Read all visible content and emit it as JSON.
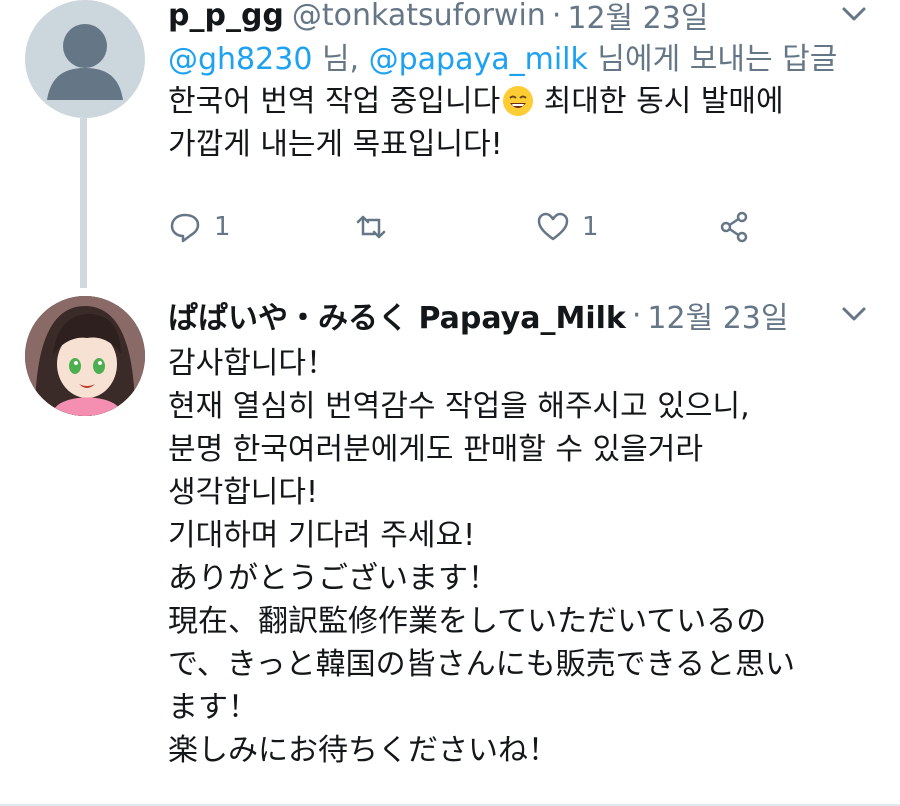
{
  "tweet1": {
    "name": "p_p_gg",
    "handle": "@tonkatsuforwin",
    "separator": "·",
    "time": "12월 23일",
    "reply_mention1": "@gh8230",
    "reply_mid": " 님, ",
    "reply_mention2": "@papaya_milk",
    "reply_suffix": " 님에게 보내는 답글",
    "body_line1a": "한국어 번역 작업 중입니다",
    "body_line1b": " 최대한 동시 발매에",
    "body_line2": "가깝게 내는게 목표입니다!",
    "reply_count": "1",
    "like_count": "1"
  },
  "tweet2": {
    "name": "ぱぱいや・みるく Papaya_Milk",
    "separator": "·",
    "time": "12월 23일",
    "body": "감사합니다！\n현재 열심히 번역감수 작업을 해주시고 있으니,\n분명 한국여러분에게도 판매할 수 있을거라\n생각합니다!\n기대하며 기다려 주세요!\nありがとうございます！\n現在、翻訳監修作業をしていただいているの\nで、きっと韓国の皆さんにも販売できると思い\nます！\n楽しみにお待ちくださいね！"
  },
  "colors": {
    "accent": "#1da1f2",
    "muted": "#657786",
    "text": "#14171a",
    "thread_line": "#cfd9de"
  },
  "icons": [
    "reply-icon",
    "retweet-icon",
    "like-icon",
    "share-icon",
    "chevron-down-icon",
    "smiling-face-emoji"
  ]
}
